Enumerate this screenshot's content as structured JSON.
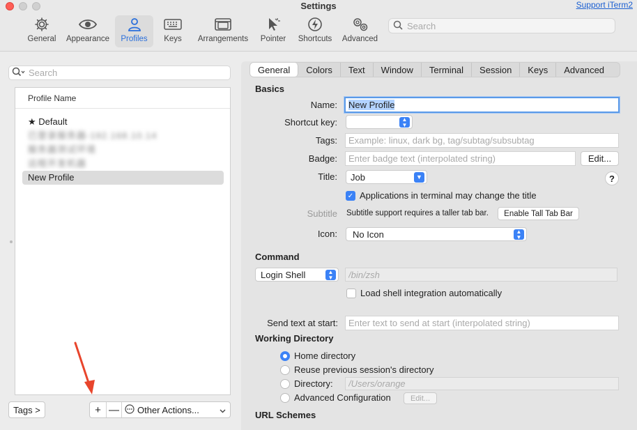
{
  "window": {
    "title": "Settings",
    "support_link": "Support iTerm2"
  },
  "toolbar": {
    "items": [
      {
        "label": "General",
        "icon": "gear-icon"
      },
      {
        "label": "Appearance",
        "icon": "eye-icon"
      },
      {
        "label": "Profiles",
        "icon": "person-icon"
      },
      {
        "label": "Keys",
        "icon": "keyboard-icon"
      },
      {
        "label": "Arrangements",
        "icon": "window-arrangement-icon"
      },
      {
        "label": "Pointer",
        "icon": "pointer-icon"
      },
      {
        "label": "Shortcuts",
        "icon": "lightning-icon"
      },
      {
        "label": "Advanced",
        "icon": "gears-icon"
      }
    ],
    "active": "Profiles",
    "search_placeholder": "Search"
  },
  "left": {
    "search_placeholder": "Search",
    "header": "Profile Name",
    "profiles": [
      {
        "name": "★ Default"
      },
      {
        "name": "已登录服务器-192.168.10.14"
      },
      {
        "name": "服务器测试环境"
      },
      {
        "name": "远程开发机器"
      },
      {
        "name": "New Profile"
      }
    ],
    "tags_button": "Tags >",
    "add_button": "+",
    "remove_button": "—",
    "other_actions": "Other Actions...",
    "other_actions_icon": "ellipsis-circle-icon"
  },
  "tabs": [
    "General",
    "Colors",
    "Text",
    "Window",
    "Terminal",
    "Session",
    "Keys",
    "Advanced"
  ],
  "active_tab": "General",
  "basics": {
    "heading": "Basics",
    "name_label": "Name:",
    "name_value": "New Profile",
    "shortcut_label": "Shortcut key:",
    "tags_label": "Tags:",
    "tags_placeholder": "Example: linux, dark bg, tag/subtag/subsubtag",
    "badge_label": "Badge:",
    "badge_placeholder": "Enter badge text (interpolated string)",
    "badge_edit": "Edit...",
    "title_label": "Title:",
    "title_value": "Job",
    "help": "?",
    "apps_change_title": "Applications in terminal may change the title",
    "subtitle_label": "Subtitle",
    "subtitle_note": "Subtitle support requires a taller tab bar.",
    "enable_tall_tab_bar": "Enable Tall Tab Bar",
    "icon_label": "Icon:",
    "icon_value": "No Icon"
  },
  "command": {
    "heading": "Command",
    "mode": "Login Shell",
    "path_placeholder": "/bin/zsh",
    "load_shell_integration": "Load shell integration automatically",
    "send_text_label": "Send text at start:",
    "send_text_placeholder": "Enter text to send at start (interpolated string)"
  },
  "working_directory": {
    "heading": "Working Directory",
    "home": "Home directory",
    "reuse": "Reuse previous session's directory",
    "directory": "Directory:",
    "directory_placeholder": "/Users/orange",
    "advanced": "Advanced Configuration",
    "advanced_edit": "Edit..."
  },
  "url_schemes": {
    "heading": "URL Schemes"
  },
  "colors": {
    "accent": "#3b82f6",
    "annotation_arrow": "#e8452c"
  }
}
